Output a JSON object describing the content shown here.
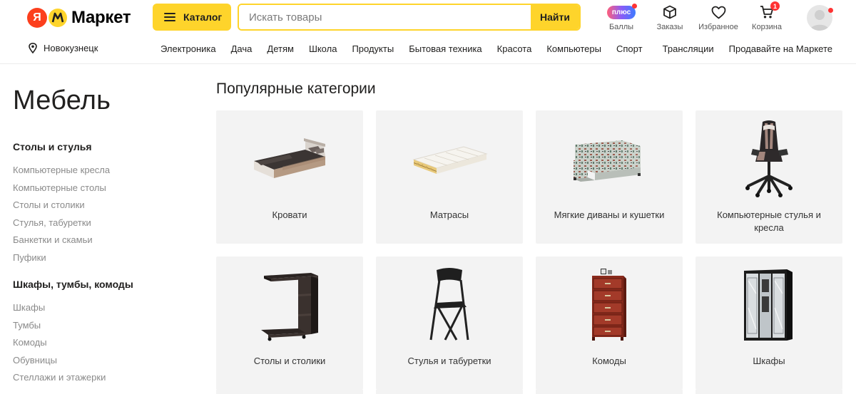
{
  "header": {
    "logo_text": "Маркет",
    "logo_letter": "Я",
    "catalog_label": "Каталог",
    "search_placeholder": "Искать товары",
    "search_button": "Найти",
    "plus_badge": "плюс",
    "icons": {
      "points": "Баллы",
      "orders": "Заказы",
      "favorites": "Избранное",
      "cart": "Корзина",
      "cart_count": "1"
    }
  },
  "nav": {
    "city": "Новокузнецк",
    "categories": [
      "Электроника",
      "Дача",
      "Детям",
      "Школа",
      "Продукты",
      "Бытовая техника",
      "Красота",
      "Компьютеры",
      "Спорт"
    ],
    "right": [
      "Трансляции",
      "Продавайте на Маркете"
    ]
  },
  "sidebar": {
    "title": "Мебель",
    "groups": [
      {
        "title": "Столы и стулья",
        "items": [
          "Компьютерные кресла",
          "Компьютерные столы",
          "Столы и столики",
          "Стулья, табуретки",
          "Банкетки и скамьи",
          "Пуфики"
        ]
      },
      {
        "title": "Шкафы, тумбы, комоды",
        "items": [
          "Шкафы",
          "Тумбы",
          "Комоды",
          "Обувницы",
          "Стеллажи и этажерки"
        ]
      }
    ]
  },
  "main": {
    "title": "Популярные категории",
    "cards": [
      {
        "label": "Кровати",
        "icon": "bed-image"
      },
      {
        "label": "Матрасы",
        "icon": "mattress-image"
      },
      {
        "label": "Мягкие диваны и кушетки",
        "icon": "sofa-image"
      },
      {
        "label": "Компьютерные стулья и кресла",
        "icon": "gaming-chair-image"
      },
      {
        "label": "Столы и столики",
        "icon": "side-table-image"
      },
      {
        "label": "Стулья и табуретки",
        "icon": "folding-chair-image"
      },
      {
        "label": "Комоды",
        "icon": "dresser-image"
      },
      {
        "label": "Шкафы",
        "icon": "wardrobe-image"
      }
    ]
  },
  "colors": {
    "accent": "#fed42b",
    "logo_red": "#fc3f1d",
    "badge_red": "#ff3333",
    "card_bg": "#f3f3f3",
    "muted_text": "#8a8a8a"
  }
}
